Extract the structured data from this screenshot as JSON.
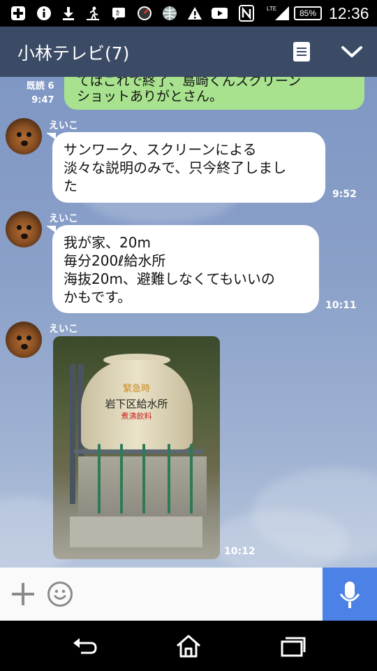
{
  "status_bar": {
    "icons": [
      "plus-icon",
      "info-icon",
      "download-icon",
      "walking-icon",
      "nfc-chat-icon",
      "speedometer-icon",
      "globe-icon",
      "warning-icon",
      "youtube-icon",
      "n-mark-icon",
      "lte-signal-icon"
    ],
    "network": "LTE",
    "battery": "85%",
    "time": "12:36"
  },
  "header": {
    "title": "小林テレビ(7)",
    "icons": [
      "note-icon",
      "chevron-down-icon"
    ]
  },
  "messages": [
    {
      "type": "mine",
      "read_label": "既読 6",
      "time": "9:47",
      "partial_text": "てはこれで終了、島崎くんスクリーン",
      "text": "ショットありがとさん。"
    },
    {
      "type": "theirs",
      "sender": "えいこ",
      "lines": [
        "サンワーク、スクリーンによる",
        "淡々な説明のみで、只今終了しまし",
        "た"
      ],
      "time": "9:52"
    },
    {
      "type": "theirs",
      "sender": "えいこ",
      "lines": [
        "我が家、20m",
        "毎分200ℓ給水所",
        "海抜20m、避難しなくてもいいの",
        "かもです。"
      ],
      "time": "10:11"
    },
    {
      "type": "theirs-image",
      "sender": "えいこ",
      "image_text": [
        "緊急時",
        "岩下区給水所",
        "煮沸飲料"
      ],
      "time": "10:12"
    }
  ],
  "input_bar": {
    "icons": [
      "plus-icon",
      "smiley-icon",
      "microphone-icon"
    ]
  },
  "nav_bar": {
    "icons": [
      "back-icon",
      "home-icon",
      "recent-apps-icon"
    ]
  },
  "colors": {
    "header": "#3b4b66",
    "mine_bubble": "#a8e28e",
    "theirs_bubble": "#ffffff",
    "mic_button": "#4c82e6",
    "chat_background": "#8aa0c9"
  }
}
